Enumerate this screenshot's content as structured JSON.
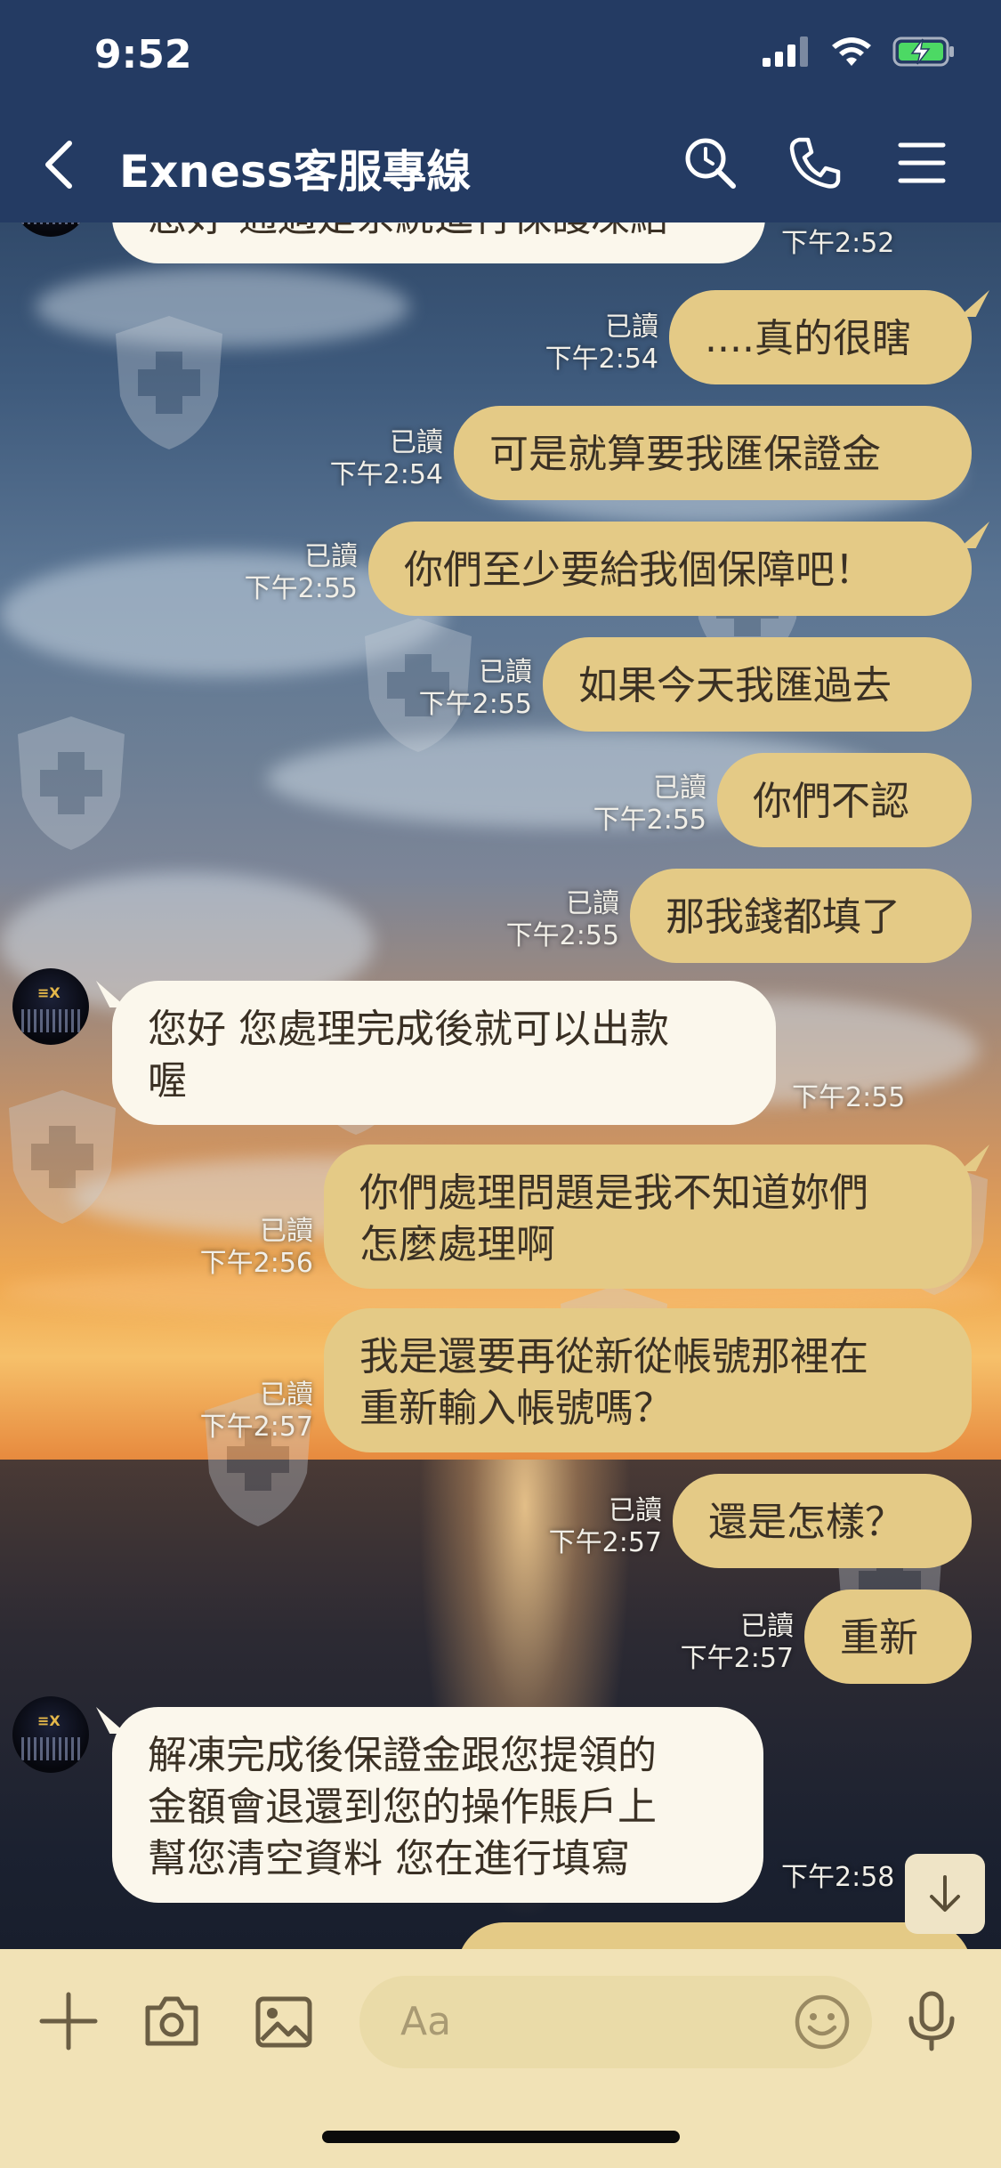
{
  "status_bar": {
    "time": "9:52"
  },
  "header": {
    "title": "Exness客服專線"
  },
  "messages": [
    {
      "from": "agent",
      "text": "您好 通過是系統進行保護凍結",
      "time": "下午2:52"
    },
    {
      "from": "me",
      "text": "....真的很瞎",
      "read": "已讀",
      "time": "下午2:54"
    },
    {
      "from": "me",
      "text": "可是就算要我匯保證金",
      "read": "已讀",
      "time": "下午2:54"
    },
    {
      "from": "me",
      "text": "你們至少要給我個保障吧！",
      "read": "已讀",
      "time": "下午2:55"
    },
    {
      "from": "me",
      "text": "如果今天我匯過去",
      "read": "已讀",
      "time": "下午2:55"
    },
    {
      "from": "me",
      "text": "你們不認",
      "read": "已讀",
      "time": "下午2:55"
    },
    {
      "from": "me",
      "text": "那我錢都填了",
      "read": "已讀",
      "time": "下午2:55"
    },
    {
      "from": "agent",
      "text": "您好 您處理完成後就可以出款喔",
      "line1": "您好  您處理完成後就可以出款",
      "line2": "喔",
      "time": "下午2:55"
    },
    {
      "from": "me",
      "line1": "你們處理問題是我不知道妳們",
      "line2": "怎麼處理啊",
      "read": "已讀",
      "time": "下午2:56"
    },
    {
      "from": "me",
      "line1": "我是還要再從新從帳號那裡在",
      "line2": "重新輸入帳號嗎？",
      "read": "已讀",
      "time": "下午2:57"
    },
    {
      "from": "me",
      "text": "還是怎樣？",
      "read": "已讀",
      "time": "下午2:57"
    },
    {
      "from": "me",
      "text": "重新",
      "read": "已讀",
      "time": "下午2:57"
    },
    {
      "from": "agent",
      "line1": "解凍完成後保證金跟您提領的",
      "line2": "金額會退還到您的操作賬戶上",
      "line3": "幫您清空資料 您在進行填寫",
      "time": "下午2:58"
    }
  ],
  "composer": {
    "placeholder": "Aa"
  },
  "icons": [
    "back-arrow-icon",
    "search-icon",
    "phone-icon",
    "menu-icon",
    "plus-icon",
    "camera-icon",
    "image-icon",
    "emoji-icon",
    "microphone-icon",
    "arrow-down-icon"
  ],
  "colors": {
    "header_bg": "#243b63",
    "outgoing_bubble": "#e4ca86",
    "incoming_bubble": "#fbf7ec",
    "composer_bg": "#f1e2b6"
  }
}
